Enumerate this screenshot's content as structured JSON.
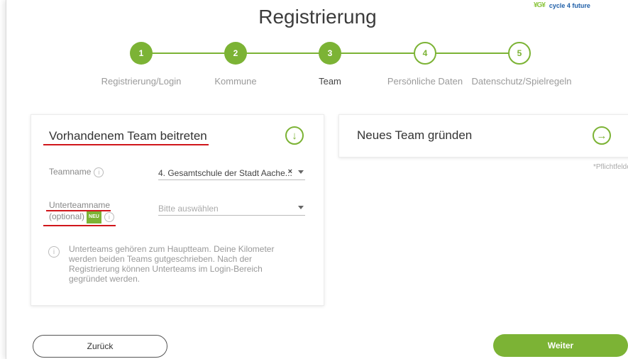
{
  "logo": {
    "text": "cycle 4 future",
    "mark": "¥G¥"
  },
  "page": {
    "title": "Registrierung"
  },
  "steps": [
    {
      "number": "1",
      "label": "Registrierung/Login"
    },
    {
      "number": "2",
      "label": "Kommune"
    },
    {
      "number": "3",
      "label": "Team"
    },
    {
      "number": "4",
      "label": "Persönliche Daten"
    },
    {
      "number": "5",
      "label": "Datenschutz/Spielregeln"
    }
  ],
  "join_team": {
    "title": "Vorhandenem Team beitreten",
    "team_label": "Teamname",
    "team_value": "4. Gesamtschule der Stadt Aache...",
    "clear": "×",
    "subteam_label_line1": "Unterteamname",
    "subteam_label_line2": "(optional)",
    "badge": "NEU",
    "subteam_placeholder": "Bitte auswählen",
    "hint": "Unterteams gehören zum Hauptteam. Deine Kilometer werden beiden Teams gutgeschrieben. Nach der Registrierung können Unterteams im Login-Bereich gegründet werden."
  },
  "new_team": {
    "title": "Neues Team gründen"
  },
  "required_note": "*Pflichtfelder",
  "buttons": {
    "back": "Zurück",
    "next": "Weiter"
  },
  "colors": {
    "accent": "#7cb335",
    "annotation": "#d0161b"
  },
  "icons": {
    "info": "i",
    "arrow_down": "↓",
    "arrow_right": "→"
  }
}
